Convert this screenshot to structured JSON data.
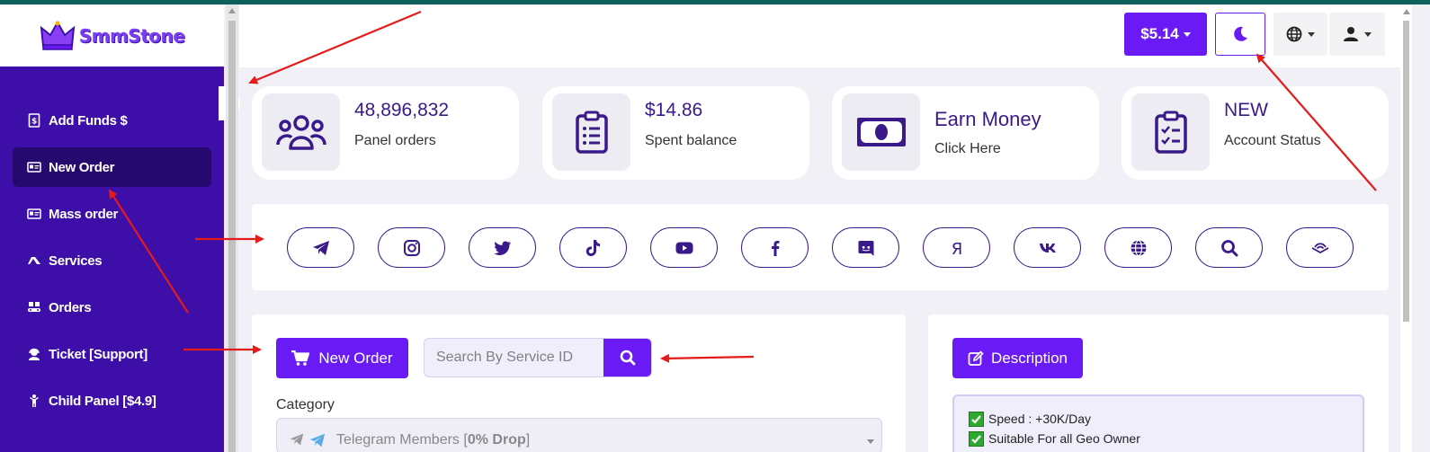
{
  "brand": {
    "name": "SmmStone"
  },
  "sidebar": {
    "items": [
      {
        "label": "Add Funds $",
        "icon": "receipt-icon",
        "active": false
      },
      {
        "label": "New Order",
        "icon": "id-card-icon",
        "active": true
      },
      {
        "label": "Mass order",
        "icon": "id-card-icon",
        "active": false
      },
      {
        "label": "Services",
        "icon": "tag-icon",
        "active": false
      },
      {
        "label": "Orders",
        "icon": "conveyor-icon",
        "active": false
      },
      {
        "label": "Ticket [Support]",
        "icon": "support-agent-icon",
        "active": false
      },
      {
        "label": "Child Panel [$4.9]",
        "icon": "child-icon",
        "active": false
      }
    ],
    "collapse_label": "«"
  },
  "header": {
    "balance": "$5.14",
    "theme_icon": "moon-icon",
    "language_icon": "globe-icon",
    "user_icon": "user-icon"
  },
  "stats": [
    {
      "value": "48,896,832",
      "label": "Panel orders",
      "icon": "users-icon"
    },
    {
      "value": "$14.86",
      "label": "Spent balance",
      "icon": "clipboard-list-icon"
    },
    {
      "value": "Earn Money",
      "label": "Click Here",
      "icon": "money-bill-icon"
    },
    {
      "value": "NEW",
      "label": "Account Status",
      "icon": "clipboard-check-icon"
    }
  ],
  "social_filters": [
    "telegram-icon",
    "instagram-icon",
    "twitter-icon",
    "tiktok-icon",
    "youtube-icon",
    "facebook-icon",
    "discord-icon",
    "yandex-icon",
    "vk-icon",
    "globe-icon",
    "search-icon",
    "audible-icon"
  ],
  "order": {
    "new_order_label": "New Order",
    "search_placeholder": "Search By Service ID",
    "category_label": "Category",
    "category_value_prefix": "Telegram Members [",
    "category_value_bold": "0% Drop",
    "category_value_suffix": "]"
  },
  "description": {
    "button_label": "Description",
    "lines": [
      "Speed : +30K/Day",
      "Suitable For all Geo Owner"
    ]
  },
  "colors": {
    "sidebar": "#3d0fa8",
    "accent": "#6a1bf5",
    "annotation": "#e31b1b"
  }
}
